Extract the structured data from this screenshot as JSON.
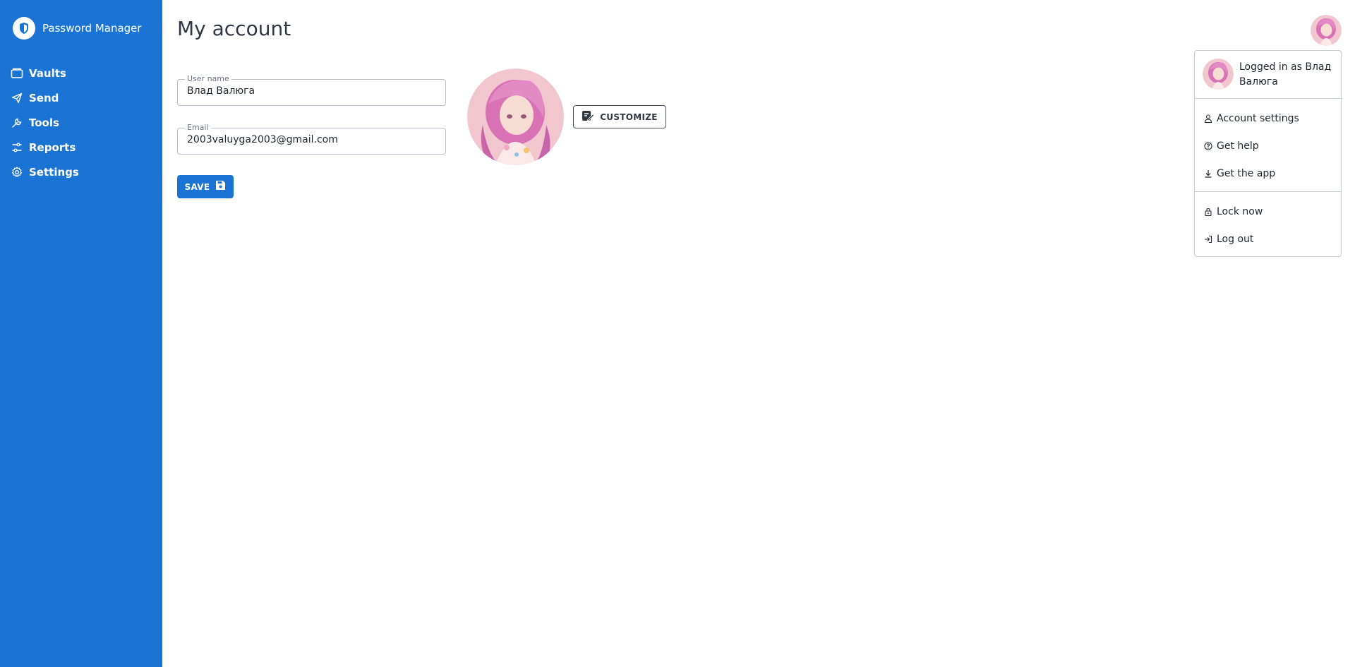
{
  "app": {
    "name": "Password Manager"
  },
  "sidebar": {
    "items": [
      {
        "label": "Vaults",
        "icon": "vault-icon"
      },
      {
        "label": "Send",
        "icon": "send-icon"
      },
      {
        "label": "Tools",
        "icon": "wrench-icon"
      },
      {
        "label": "Reports",
        "icon": "sliders-icon"
      },
      {
        "label": "Settings",
        "icon": "gear-icon"
      }
    ]
  },
  "page": {
    "title": "My account"
  },
  "form": {
    "username": {
      "label": "User name",
      "value": "Влад Валюга"
    },
    "email": {
      "label": "Email",
      "value": "2003valuyga2003@gmail.com"
    },
    "save_label": "SAVE",
    "customize_label": "CUSTOMIZE"
  },
  "account_menu": {
    "logged_in_text": "Logged in as Влад Валюга",
    "items": [
      {
        "label": "Account settings",
        "icon": "user-icon"
      },
      {
        "label": "Get help",
        "icon": "help-circle-icon"
      },
      {
        "label": "Get the app",
        "icon": "download-icon"
      },
      {
        "label": "Lock now",
        "icon": "lock-icon"
      },
      {
        "label": "Log out",
        "icon": "logout-icon"
      }
    ]
  },
  "colors": {
    "accent": "#1b74d4",
    "sidebar_bg": "#1b74d4"
  }
}
